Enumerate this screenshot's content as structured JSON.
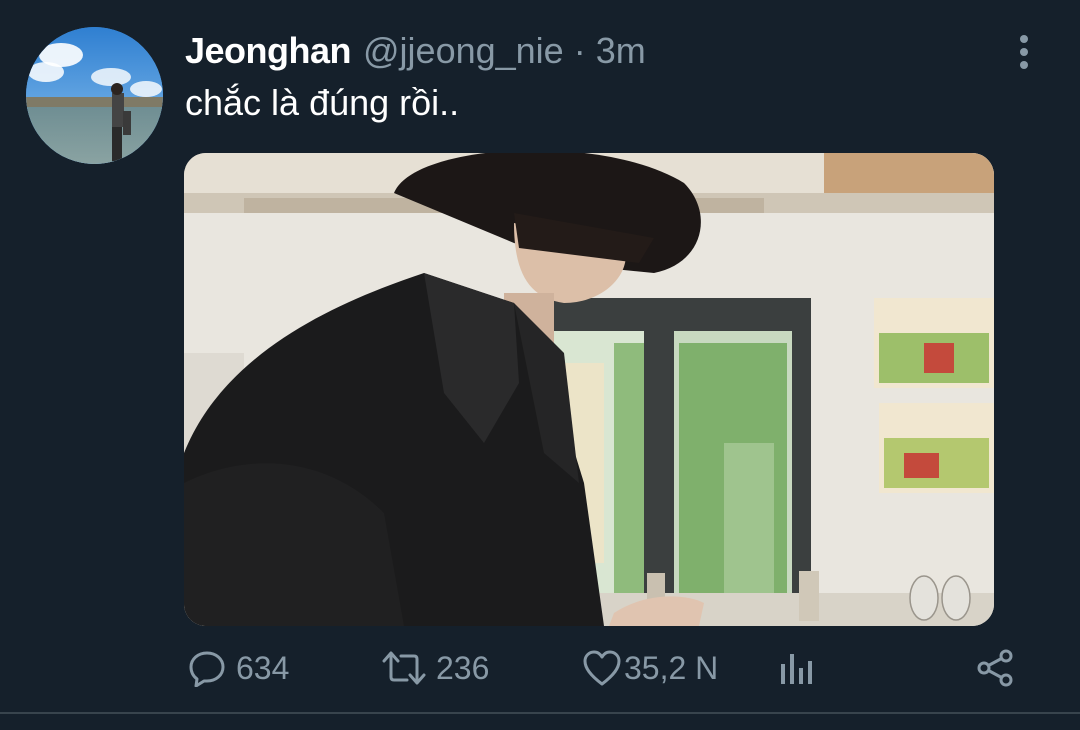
{
  "tweet": {
    "display_name": "Jeonghan",
    "handle": "@jjeong_nie",
    "separator": "·",
    "time": "3m",
    "text": "chắc là đúng rồi..",
    "avatar_icon": "profile-photo",
    "media_icon": "photo",
    "more_icon": "vertical-ellipsis-icon"
  },
  "actions": {
    "replies": "634",
    "retweets": "236",
    "likes": "35,2 N",
    "reply_icon": "speech-bubble-icon",
    "retweet_icon": "retweet-icon",
    "like_icon": "heart-icon",
    "analytics_icon": "bar-chart-icon",
    "share_icon": "share-icon"
  },
  "colors": {
    "background": "#15202b",
    "secondary_text": "#8899a6",
    "primary_text": "#ffffff",
    "divider": "#38444d"
  }
}
